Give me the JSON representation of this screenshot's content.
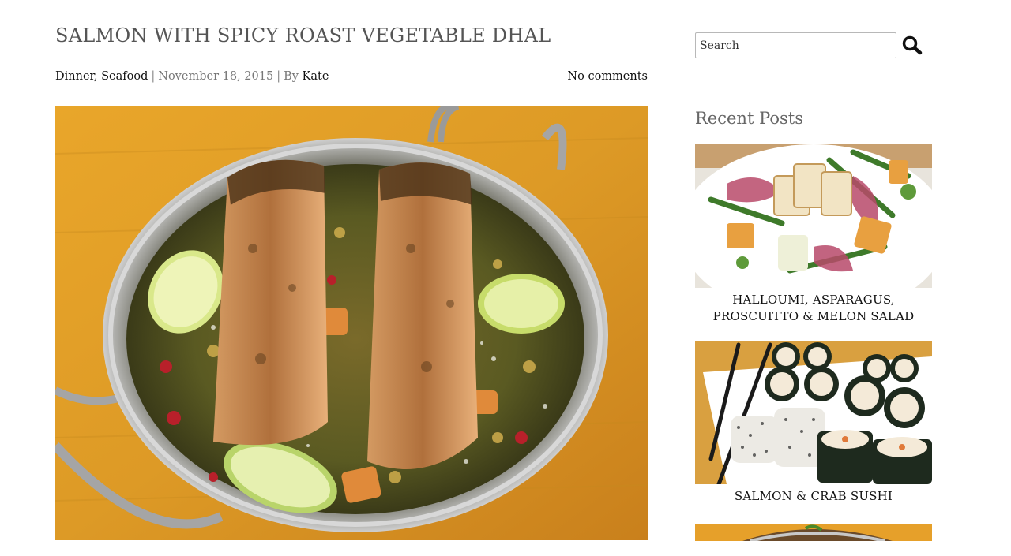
{
  "post": {
    "title": "SALMON WITH SPICY ROAST VEGETABLE DHAL",
    "categories": [
      "Dinner",
      "Seafood"
    ],
    "date": "November 18, 2015",
    "by_label": "By",
    "author": "Kate",
    "comments": "No comments"
  },
  "sidebar": {
    "search": {
      "placeholder": "Search",
      "value": ""
    },
    "recent_posts_title": "Recent Posts",
    "recent_posts": [
      {
        "title": "HALLOUMI, ASPARAGUS, PROSCUITTO & MELON SALAD"
      },
      {
        "title": "SALMON & CRAB SUSHI"
      },
      {
        "title": ""
      }
    ]
  }
}
